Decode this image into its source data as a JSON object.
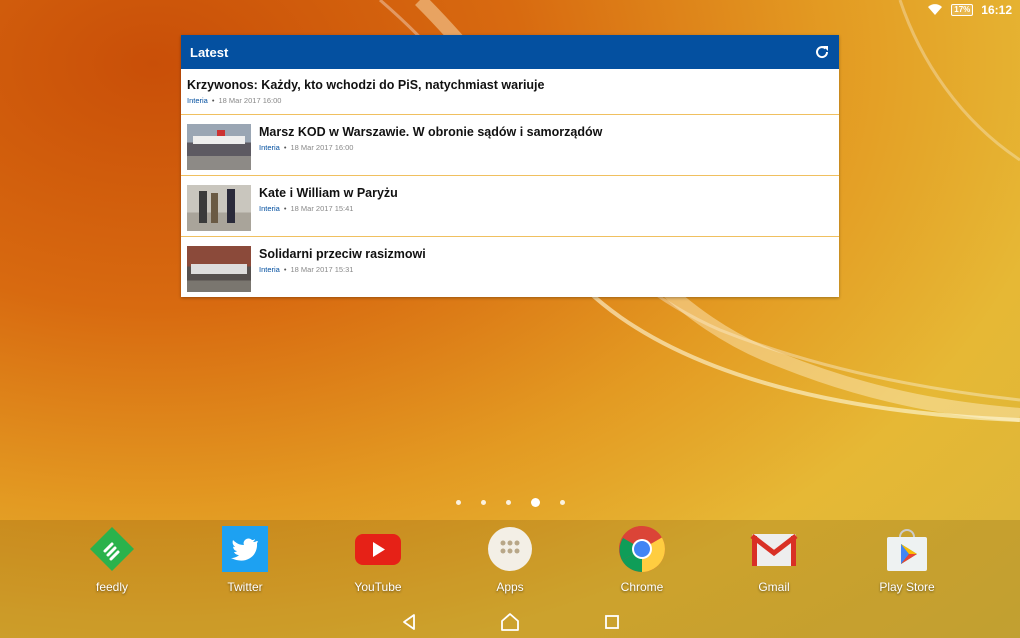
{
  "status": {
    "battery": "17%",
    "time": "16:12",
    "wifi_icon": "wifi-icon"
  },
  "widget": {
    "title": "Latest",
    "header_color": "#0450a0",
    "items": [
      {
        "title": "Krzywonos: Każdy, kto wchodzi do PiS, natychmiast wariuje",
        "source": "Interia",
        "date": "18 Mar 2017 16:00"
      },
      {
        "title": "Marsz KOD w Warszawie. W obronie sądów i samorządów",
        "source": "Interia",
        "date": "18 Mar 2017 16:00"
      },
      {
        "title": "Kate i William w Paryżu",
        "source": "Interia",
        "date": "18 Mar 2017 15:41"
      },
      {
        "title": "Solidarni przeciw rasizmowi",
        "source": "Interia",
        "date": "18 Mar 2017 15:31"
      }
    ]
  },
  "home": {
    "page_count": 5,
    "active_page": 4
  },
  "dock": {
    "apps": [
      {
        "label": "feedly",
        "icon": "feedly-icon"
      },
      {
        "label": "Twitter",
        "icon": "twitter-icon"
      },
      {
        "label": "YouTube",
        "icon": "youtube-icon"
      },
      {
        "label": "Apps",
        "icon": "apps-icon"
      },
      {
        "label": "Chrome",
        "icon": "chrome-icon"
      },
      {
        "label": "Gmail",
        "icon": "gmail-icon"
      },
      {
        "label": "Play Store",
        "icon": "play-store-icon"
      }
    ]
  },
  "navbar": {
    "back": "back-icon",
    "home": "home-icon",
    "recents": "recents-icon"
  }
}
